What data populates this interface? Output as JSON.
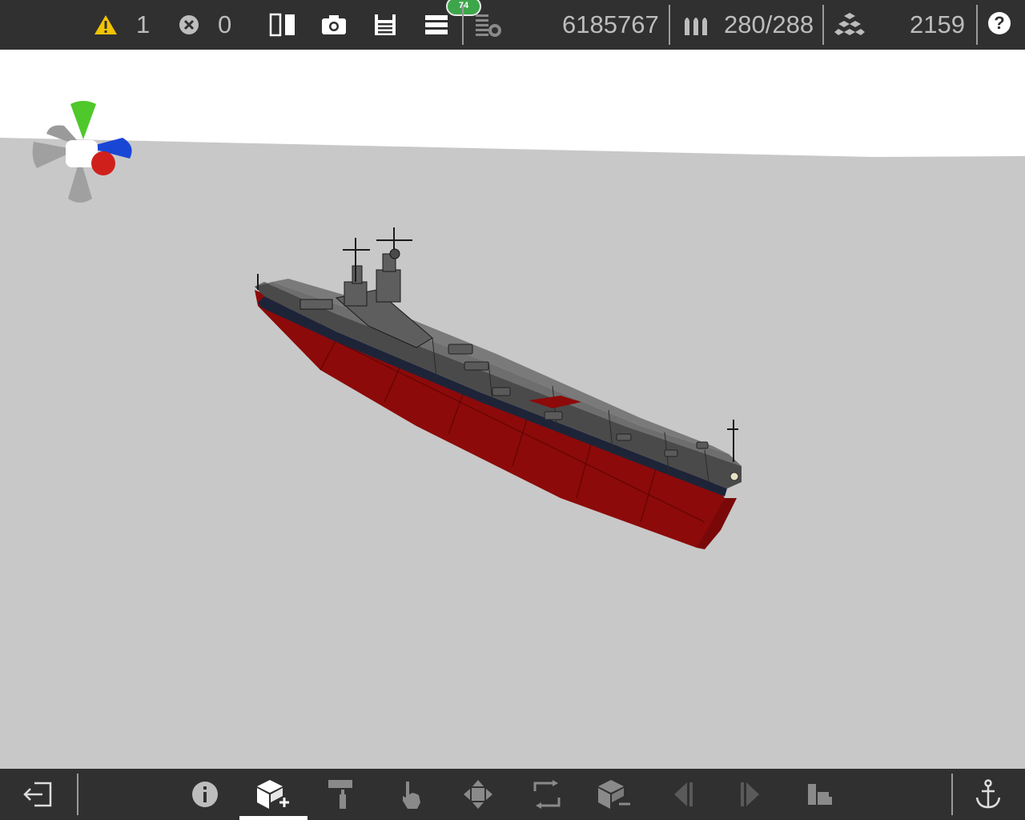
{
  "topbar": {
    "warnings_count": "1",
    "errors_count": "0",
    "notification_count": "74",
    "block_count": "6185767",
    "ammo": "280/288",
    "vertex_count": "2159",
    "help_label": "?",
    "icons": [
      "warning-icon",
      "error-icon",
      "mirror-icon",
      "camera-icon",
      "save-icon",
      "menu-icon",
      "layers-icon",
      "blocks-icon",
      "ammo-icon",
      "cubes-icon",
      "help-icon"
    ]
  },
  "bottombar": {
    "tools": [
      "exit-icon",
      "info-icon",
      "add-block-icon",
      "paint-roller-icon",
      "touch-icon",
      "move-icon",
      "rotate-icon",
      "remove-block-icon",
      "prev-icon",
      "next-icon",
      "structures-icon",
      "anchor-icon"
    ],
    "active_tool": "add-block-icon"
  },
  "colors": {
    "bar_bg": "#303030",
    "viewport_bg": "#c8c8c8",
    "sky": "#ffffff",
    "hull_red": "#8c0a0a",
    "deck_gray": "#6e6e6e",
    "stripe_navy": "#1e2438",
    "gizmo_y": "#4ec82a",
    "gizmo_x": "#d0201c",
    "gizmo_z": "#1a46d6"
  }
}
